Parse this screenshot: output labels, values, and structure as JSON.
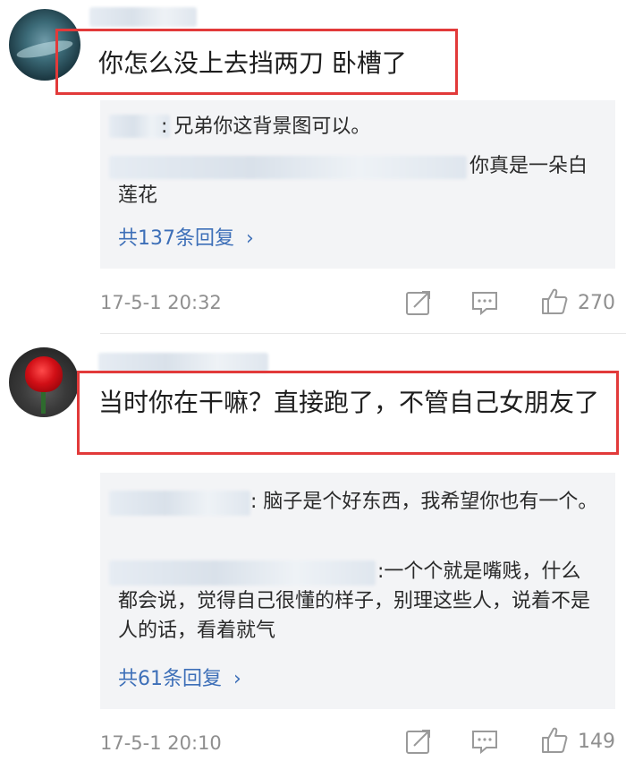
{
  "comments": [
    {
      "text": "你怎么没上去挡两刀 卧槽了",
      "replies": [
        {
          "text": "兄弟你这背景图可以。"
        },
        {
          "text": "你真是一朵白莲花"
        }
      ],
      "more_replies": "共137条回复",
      "timestamp": "17-5-1 20:32",
      "likes": "270"
    },
    {
      "text": "当时你在干嘛？直接跑了，不管自己女朋友了",
      "replies": [
        {
          "text": "脑子是个好东西，我希望你也有一个。"
        },
        {
          "text": "一个个就是嘴贱，什么都会说，觉得自己很懂的样子，别理这些人，说着不是人的话，看着就气"
        }
      ],
      "more_replies": "共61条回复",
      "timestamp": "17-5-1 20:10",
      "likes": "149"
    }
  ],
  "colors": {
    "highlight_border": "#e23a3a",
    "link": "#3d6fb8",
    "meta": "#8f8f8f",
    "reply_bg": "#f3f4f6"
  },
  "icons": {
    "share": "share-icon",
    "reply": "comment-icon",
    "like": "thumbs-up-icon"
  }
}
